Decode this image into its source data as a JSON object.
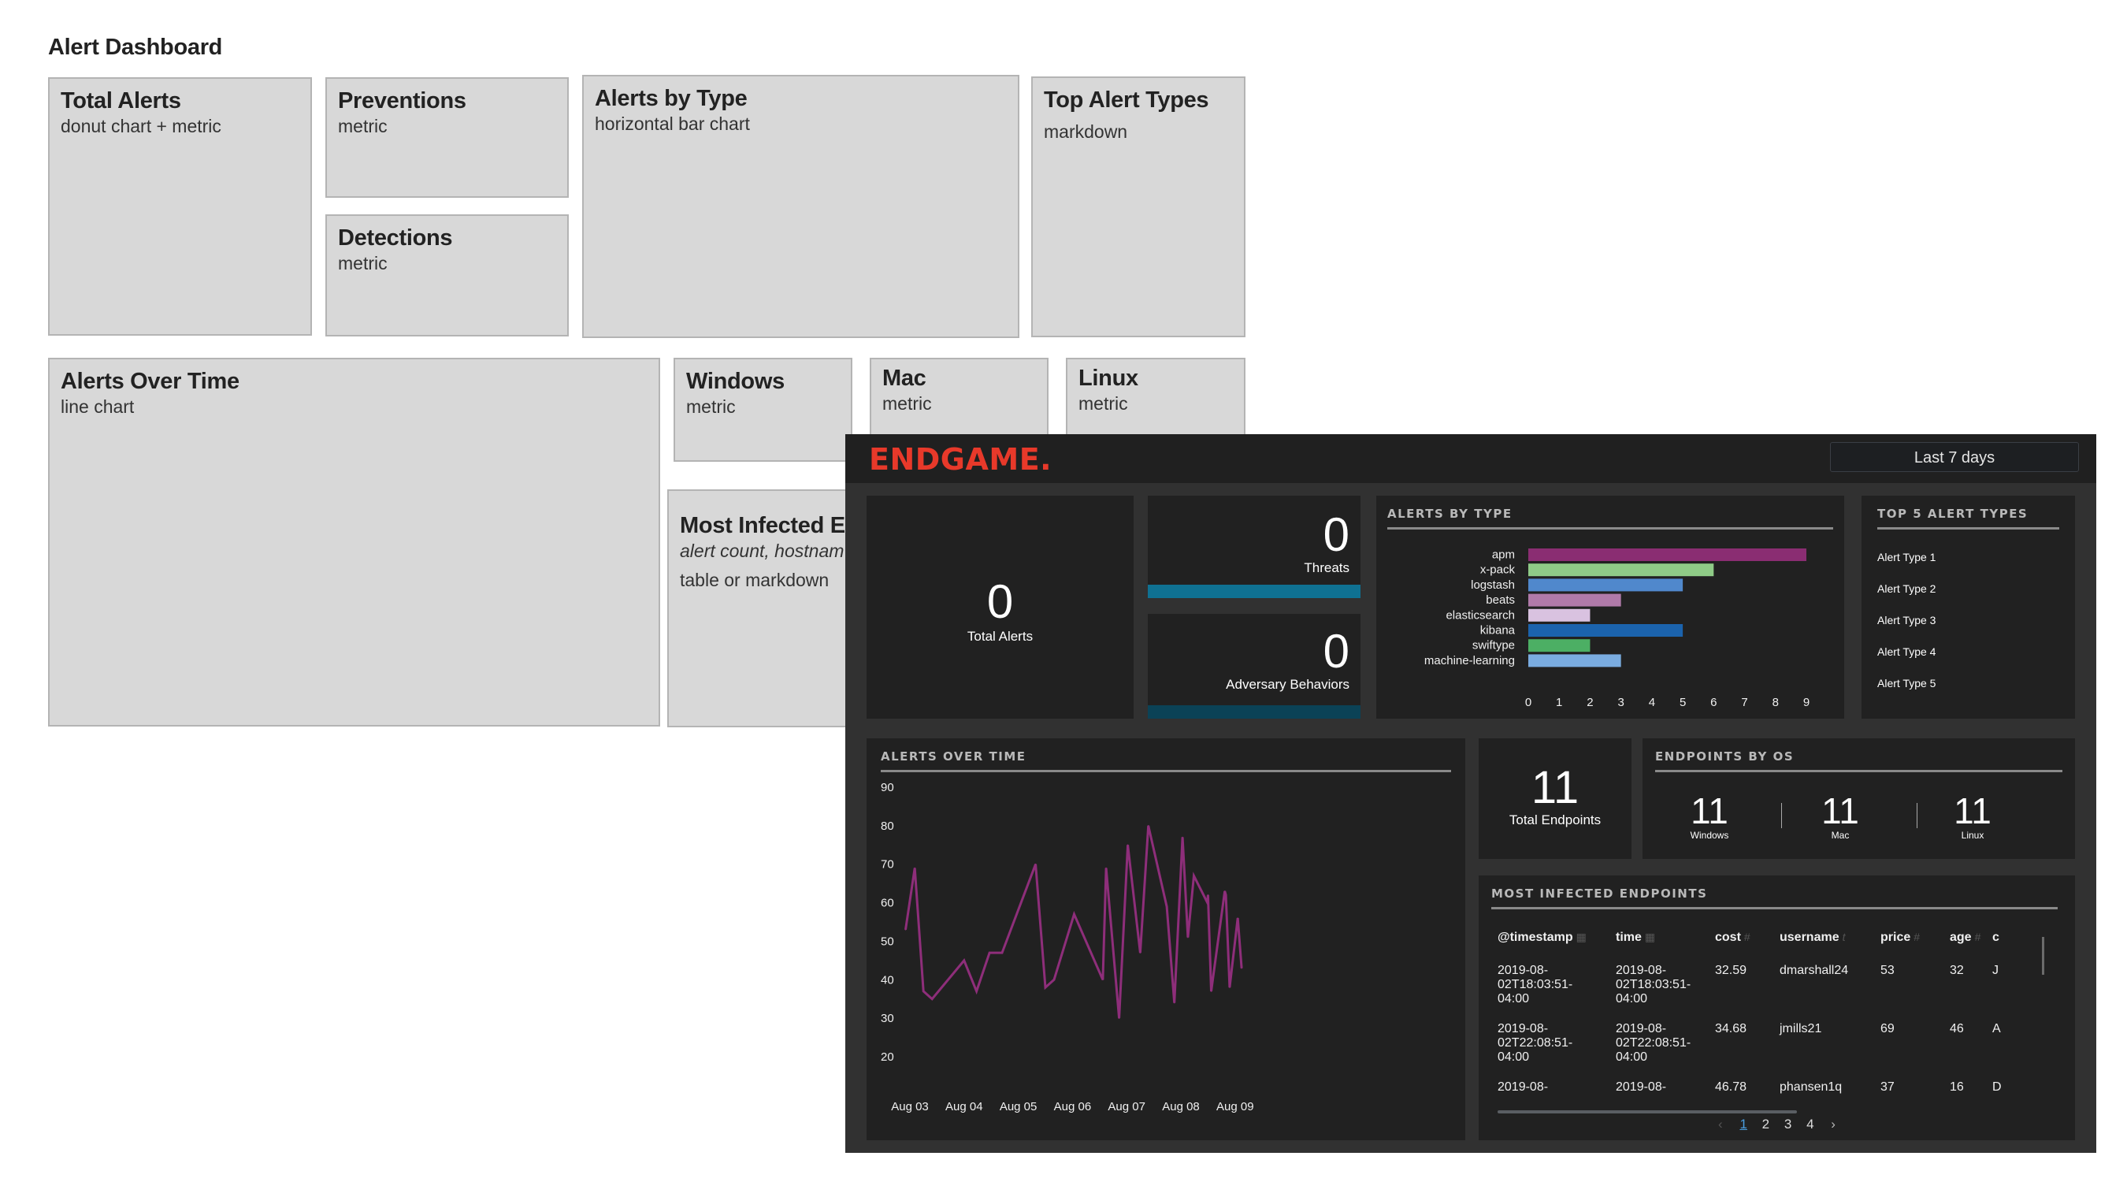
{
  "wireframe": {
    "title": "Alert Dashboard",
    "tiles": [
      {
        "title": "Total Alerts",
        "desc": "donut chart + metric"
      },
      {
        "title": "Preventions",
        "desc": "metric"
      },
      {
        "title": "Detections",
        "desc": "metric"
      },
      {
        "title": "Alerts by Type",
        "desc": "horizontal bar chart"
      },
      {
        "title": "Top Alert Types",
        "desc": "markdown"
      },
      {
        "title": "Alerts Over Time",
        "desc": "line chart"
      },
      {
        "title": "Windows",
        "desc": "metric"
      },
      {
        "title": "Mac",
        "desc": "metric"
      },
      {
        "title": "Linux",
        "desc": "metric"
      },
      {
        "title": "Most Infected E",
        "desc_italic": "alert count, hostnam",
        "desc": "table or markdown"
      }
    ]
  },
  "endgame": {
    "logo": "ENDGAME.",
    "time_range": "Last 7 days",
    "total_alerts": {
      "value": "0",
      "label": "Total Alerts"
    },
    "threats": {
      "value": "0",
      "label": "Threats",
      "bar_color": "#0f7192"
    },
    "adversary": {
      "value": "0",
      "label": "Adversary Behaviors",
      "bar_color": "#0b4256"
    },
    "alerts_by_type_title": "ALERTS BY TYPE",
    "top5": {
      "title": "TOP 5 ALERT TYPES",
      "items": [
        "Alert Type 1",
        "Alert Type 2",
        "Alert Type 3",
        "Alert Type 4",
        "Alert Type 5"
      ]
    },
    "alerts_over_time_title": "ALERTS OVER TIME",
    "total_endpoints": {
      "value": "11",
      "label": "Total Endpoints"
    },
    "endpoints_by_os": {
      "title": "ENDPOINTS BY OS",
      "items": [
        {
          "value": "11",
          "label": "Windows"
        },
        {
          "value": "11",
          "label": "Mac"
        },
        {
          "value": "11",
          "label": "Linux"
        }
      ]
    },
    "most_infected": {
      "title": "MOST INFECTED ENDPOINTS",
      "columns": [
        {
          "name": "@timestamp",
          "icon": "calendar-icon"
        },
        {
          "name": "time",
          "icon": "calendar-icon"
        },
        {
          "name": "cost",
          "icon": "number-icon"
        },
        {
          "name": "username",
          "icon": "text-icon"
        },
        {
          "name": "price",
          "icon": "number-icon"
        },
        {
          "name": "age",
          "icon": "number-icon"
        },
        {
          "name": "c",
          "icon": ""
        }
      ],
      "rows": [
        [
          "2019-08-\n02T18:03:51-\n04:00",
          "2019-08-\n02T18:03:51-\n04:00",
          "32.59",
          "dmarshall24",
          "53",
          "32",
          "J"
        ],
        [
          "2019-08-\n02T22:08:51-\n04:00",
          "2019-08-\n02T22:08:51-\n04:00",
          "34.68",
          "jmills21",
          "69",
          "46",
          "A"
        ],
        [
          "2019-08-",
          "2019-08-",
          "46.78",
          "phansen1q",
          "37",
          "16",
          "D"
        ]
      ],
      "pagination": {
        "pages": [
          "1",
          "2",
          "3",
          "4"
        ],
        "current": "1",
        "prev": "‹",
        "next": "›"
      }
    }
  },
  "chart_data": [
    {
      "type": "bar",
      "orientation": "horizontal",
      "title": "ALERTS BY TYPE",
      "categories": [
        "apm",
        "x-pack",
        "logstash",
        "beats",
        "elasticsearch",
        "kibana",
        "swiftype",
        "machine-learning"
      ],
      "values": [
        9,
        6,
        5,
        3,
        2,
        5,
        2,
        3
      ],
      "colors": [
        "#8a2d72",
        "#8fcb87",
        "#5088cc",
        "#b07aa9",
        "#d9c2e0",
        "#1b63ad",
        "#4caf64",
        "#7aace0"
      ],
      "xticks": [
        "0",
        "1",
        "2",
        "3",
        "4",
        "5",
        "6",
        "7",
        "8",
        "9"
      ],
      "xlim": [
        0,
        9
      ],
      "grid": false
    },
    {
      "type": "line",
      "title": "ALERTS OVER TIME",
      "color": "#8e2e7a",
      "x_days": [
        0.0,
        0.17,
        0.33,
        0.49,
        1.08,
        1.31,
        1.55,
        1.78,
        2.4,
        2.58,
        2.74,
        3.11,
        3.64,
        3.7,
        3.94,
        4.1,
        4.33,
        4.48,
        4.82,
        4.96,
        5.11,
        5.21,
        5.32,
        5.57,
        5.58,
        5.64,
        5.89,
        5.91,
        5.98,
        6.13,
        6.2
      ],
      "y": [
        53,
        69,
        37,
        35,
        45,
        37,
        47,
        47,
        70,
        38,
        40,
        57,
        40,
        69,
        30,
        75,
        47,
        80,
        59,
        34,
        77,
        51,
        67,
        60,
        62,
        37,
        63,
        62,
        38,
        56,
        43
      ],
      "x_start_offset_days": -0.08,
      "xticks": [
        "Aug 03",
        "Aug 04",
        "Aug 05",
        "Aug 06",
        "Aug 07",
        "Aug 08",
        "Aug 09"
      ],
      "yticks": [
        "20",
        "30",
        "40",
        "50",
        "60",
        "70",
        "80",
        "90"
      ],
      "ylim": [
        20,
        90
      ],
      "grid": false
    }
  ]
}
